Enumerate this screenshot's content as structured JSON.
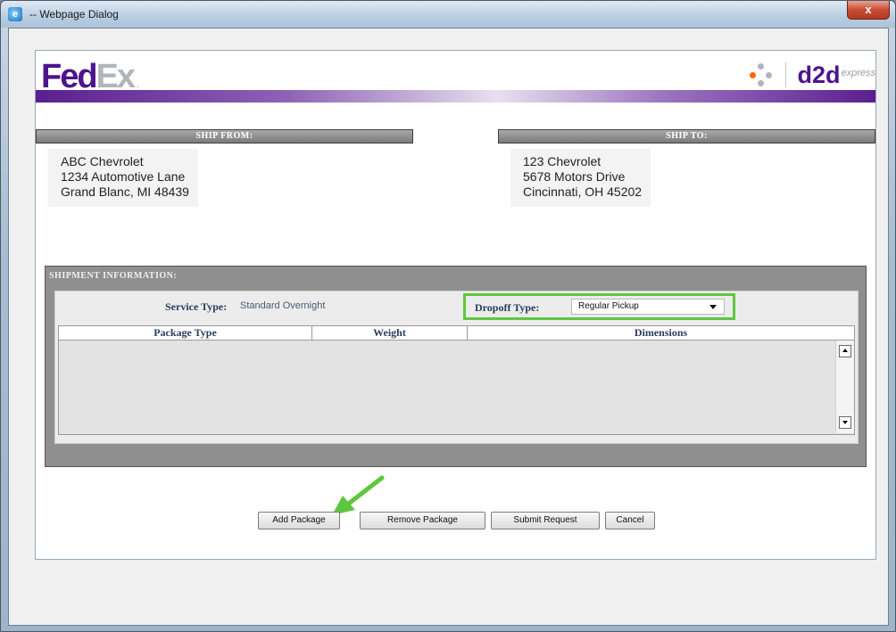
{
  "window": {
    "title": "-- Webpage Dialog",
    "close_label": "x"
  },
  "brand": {
    "logo_fed": "Fed",
    "logo_ex": "Ex",
    "logo_dot": ".",
    "partner_name": "d2d",
    "partner_suffix": "express",
    "purple": "#4d148c",
    "orange": "#ff6600",
    "highlight_green": "#5ec73e"
  },
  "ship_from": {
    "heading": "SHIP FROM:",
    "lines": [
      "ABC Chevrolet",
      "1234 Automotive Lane",
      "Grand Blanc, MI  48439"
    ]
  },
  "ship_to": {
    "heading": "SHIP TO:",
    "lines": [
      "123 Chevrolet",
      "5678 Motors Drive",
      "Cincinnati, OH  45202"
    ]
  },
  "shipment": {
    "heading": "SHIPMENT INFORMATION:",
    "service_type_label": "Service Type:",
    "service_type_value": "Standard Overnight",
    "dropoff_type_label": "Dropoff Type:",
    "dropoff_type_value": "Regular Pickup",
    "columns": [
      "Package Type",
      "Weight",
      "Dimensions"
    ]
  },
  "actions": {
    "add_package": "Add Package",
    "remove_package": "Remove Package",
    "submit_request": "Submit Request",
    "cancel": "Cancel"
  },
  "icons": {
    "app": "ie-icon",
    "brand_dots": "dots-icon",
    "select_caret": "chevron-down-icon",
    "scroll_up": "scroll-up-icon",
    "scroll_down": "scroll-down-icon",
    "pointer": "arrow-icon"
  }
}
